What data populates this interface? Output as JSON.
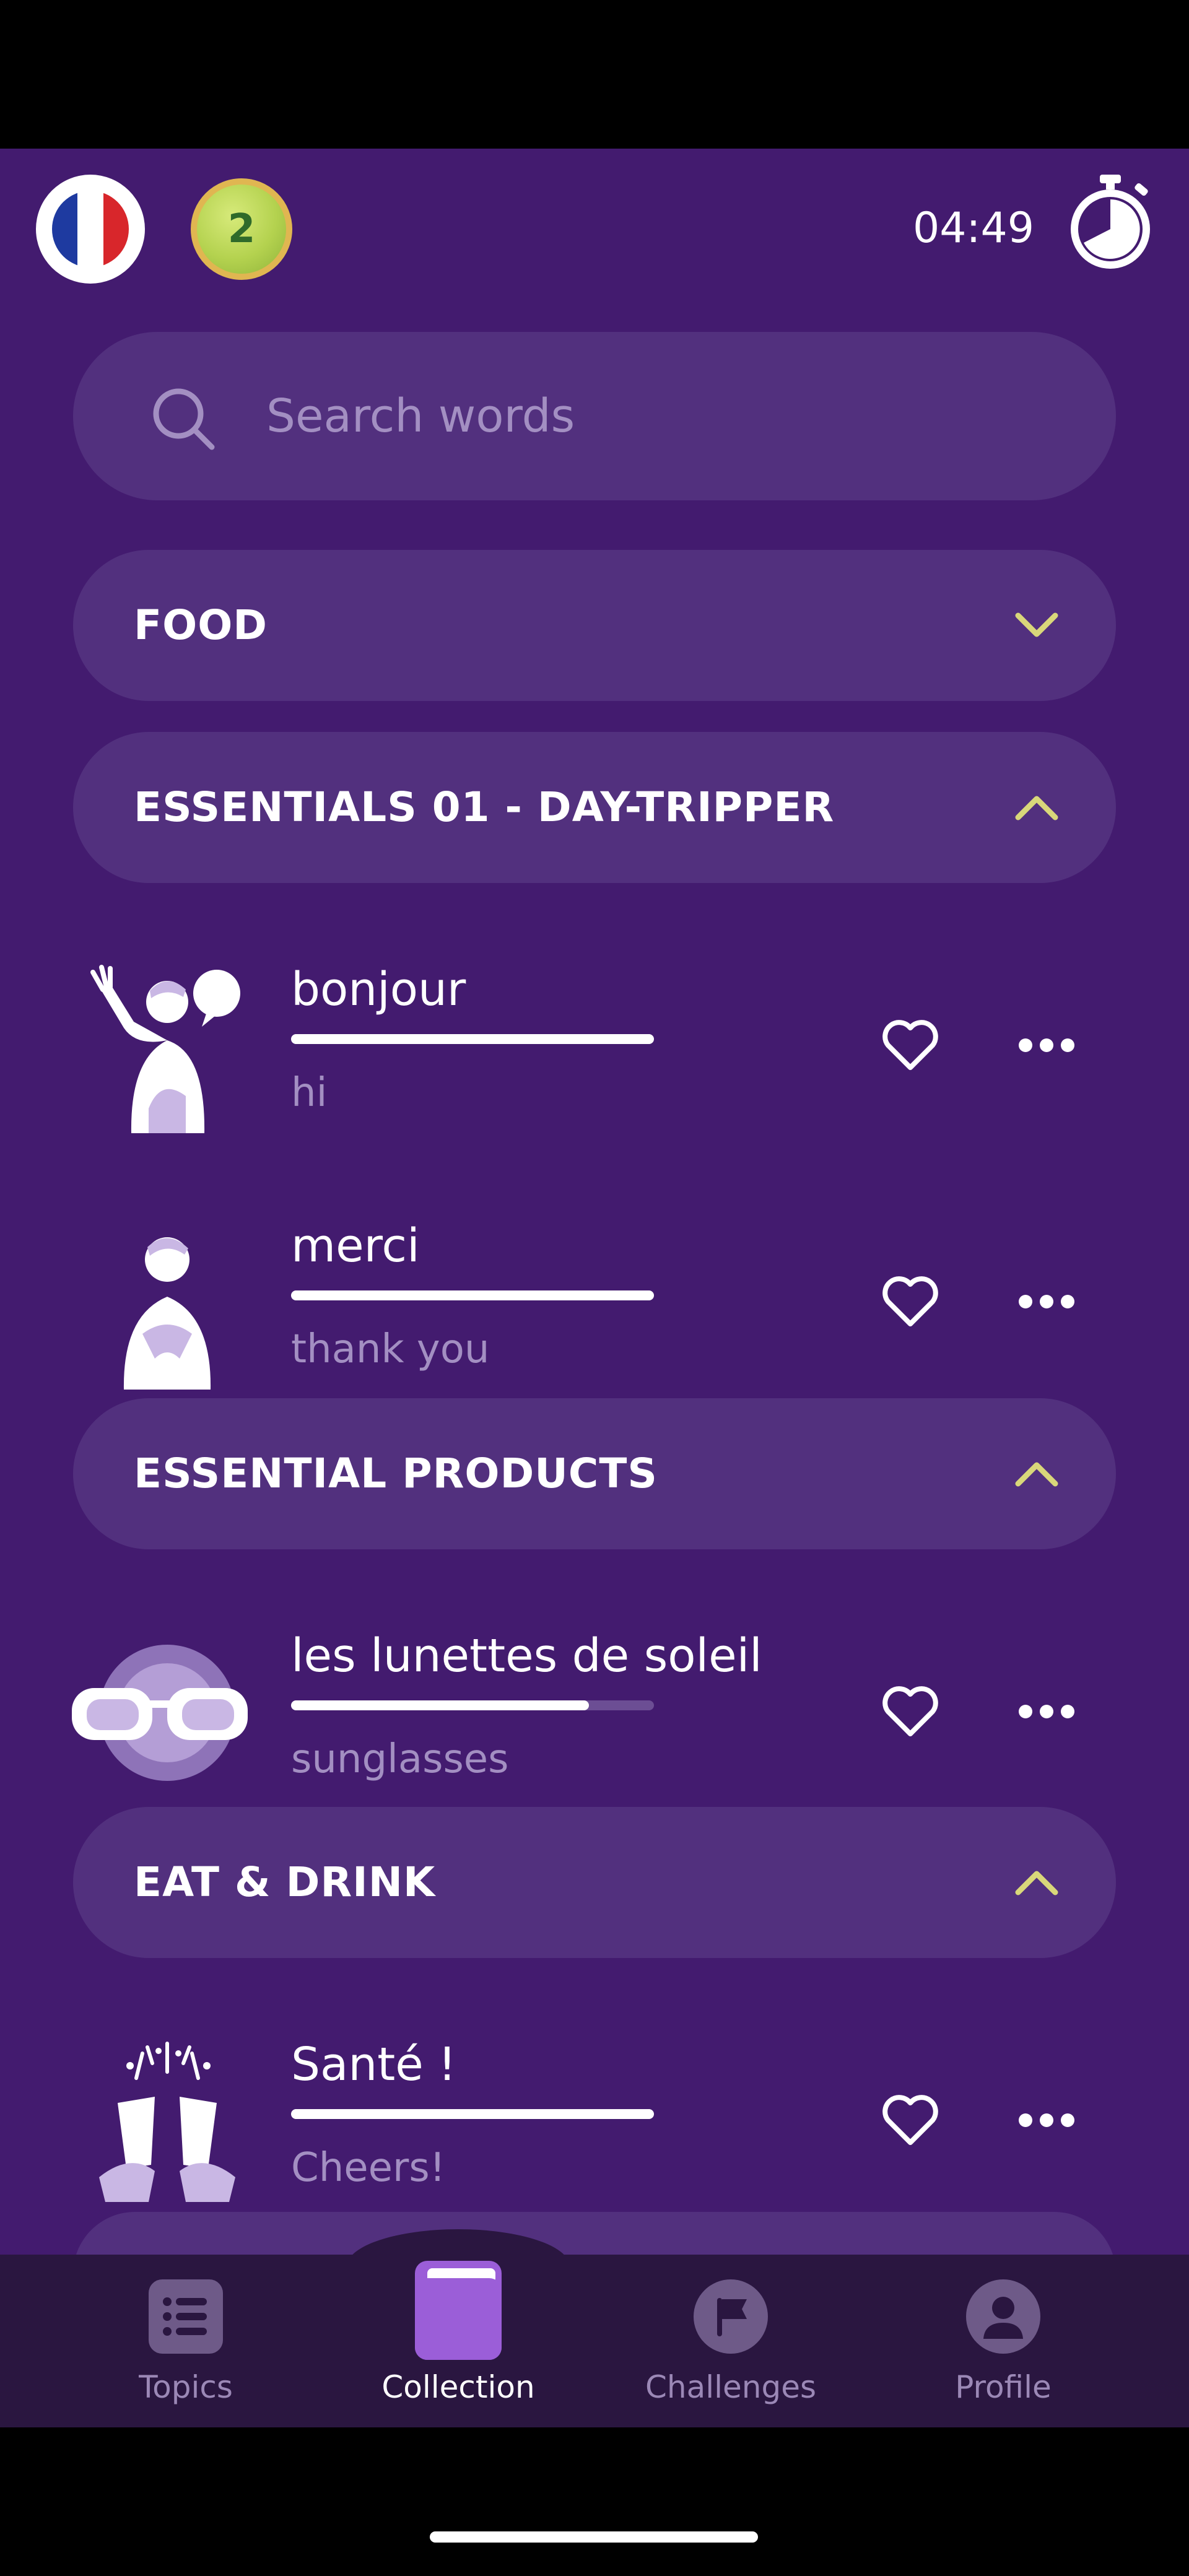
{
  "top_bar": {
    "language_flag": "france-flag-icon",
    "level": "2",
    "timer": "04:49",
    "timer_icon": "stopwatch-icon"
  },
  "search": {
    "placeholder": "Search words",
    "icon": "search-icon"
  },
  "sections": [
    {
      "title": "FOOD",
      "expanded": false
    },
    {
      "title": "ESSENTIALS 01 - DAY-TRIPPER",
      "expanded": true
    },
    {
      "title": "ESSENTIAL PRODUCTS",
      "expanded": true
    },
    {
      "title": "EAT & DRINK",
      "expanded": true
    }
  ],
  "words": [
    {
      "term": "bonjour",
      "translation": "hi",
      "progress": 1.0,
      "illustration": "waving-person-illustration"
    },
    {
      "term": "merci",
      "translation": "thank you",
      "progress": 1.0,
      "illustration": "grateful-person-illustration"
    },
    {
      "term": "les lunettes de soleil",
      "translation": "sunglasses",
      "progress": 0.82,
      "illustration": "sunglasses-illustration"
    },
    {
      "term": "Santé !",
      "translation": "Cheers!",
      "progress": 1.0,
      "illustration": "toasting-glasses-illustration"
    }
  ],
  "nav": {
    "items": [
      {
        "label": "Topics",
        "icon": "list-icon",
        "active": false
      },
      {
        "label": "Collection",
        "icon": "book-icon",
        "active": true
      },
      {
        "label": "Challenges",
        "icon": "flag-icon",
        "active": false
      },
      {
        "label": "Profile",
        "icon": "person-icon",
        "active": false
      }
    ]
  },
  "colors": {
    "background": "#431b6f",
    "card": "#52307e",
    "accent_chevron": "#d9d77a",
    "nav_background": "#2a1640",
    "collection_accent": "#9b5ed8"
  }
}
